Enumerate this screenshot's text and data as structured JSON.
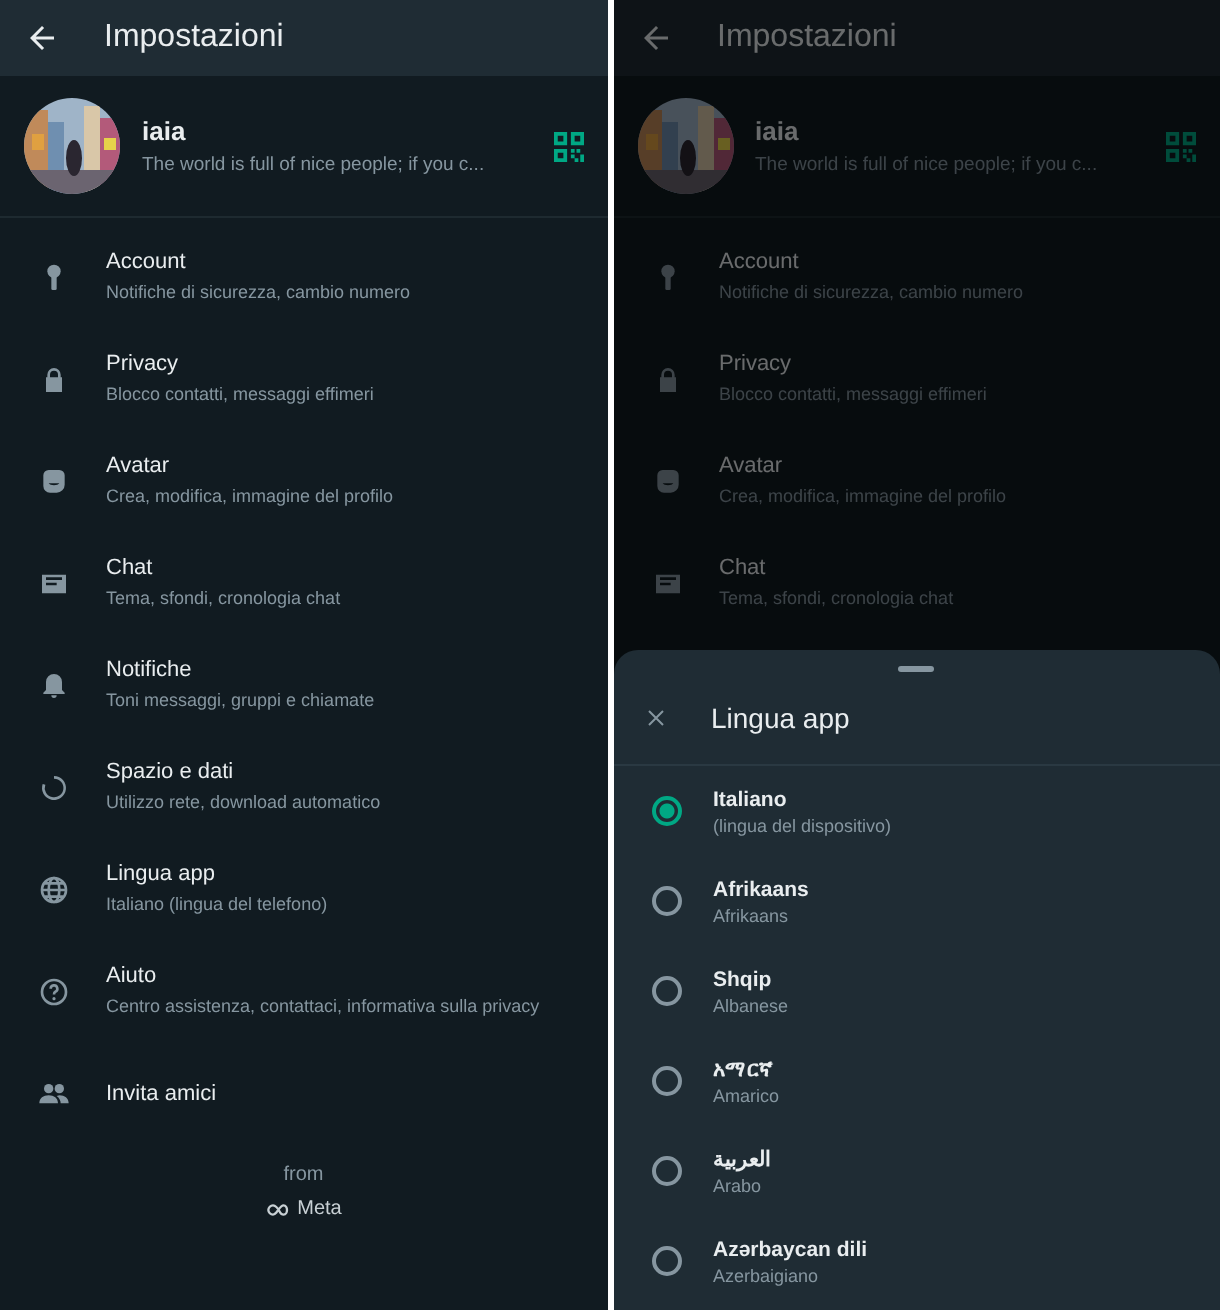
{
  "screens": [
    {
      "dimmed": false,
      "title": "Impostazioni",
      "profile": {
        "name": "iaia",
        "status": "The world is full of nice people; if you c..."
      },
      "items": [
        {
          "kind": "account",
          "title": "Account",
          "subtitle": "Notifiche di sicurezza, cambio numero"
        },
        {
          "kind": "privacy",
          "title": "Privacy",
          "subtitle": "Blocco contatti, messaggi effimeri"
        },
        {
          "kind": "avatar",
          "title": "Avatar",
          "subtitle": "Crea, modifica, immagine del profilo"
        },
        {
          "kind": "chat",
          "title": "Chat",
          "subtitle": "Tema, sfondi, cronologia chat"
        },
        {
          "kind": "notifications",
          "title": "Notifiche",
          "subtitle": "Toni messaggi, gruppi e chiamate"
        },
        {
          "kind": "storage",
          "title": "Spazio e dati",
          "subtitle": "Utilizzo rete, download automatico"
        },
        {
          "kind": "language",
          "title": "Lingua app",
          "subtitle": "Italiano (lingua del telefono)"
        },
        {
          "kind": "help",
          "title": "Aiuto",
          "subtitle": "Centro assistenza, contattaci, informativa sulla privacy"
        },
        {
          "kind": "invite",
          "title": "Invita amici"
        }
      ],
      "footer": {
        "from": "from",
        "brand": "Meta"
      }
    },
    {
      "dimmed": true,
      "title": "Impostazioni",
      "profile": {
        "name": "iaia",
        "status": "The world is full of nice people; if you c..."
      },
      "items": [
        {
          "kind": "account",
          "title": "Account",
          "subtitle": "Notifiche di sicurezza, cambio numero"
        },
        {
          "kind": "privacy",
          "title": "Privacy",
          "subtitle": "Blocco contatti, messaggi effimeri"
        },
        {
          "kind": "avatar",
          "title": "Avatar",
          "subtitle": "Crea, modifica, immagine del profilo"
        },
        {
          "kind": "chat",
          "title": "Chat",
          "subtitle": "Tema, sfondi, cronologia chat"
        }
      ],
      "sheet": {
        "title": "Lingua app",
        "options": [
          {
            "name": "Italiano",
            "detail": "(lingua del dispositivo)",
            "selected": true
          },
          {
            "name": "Afrikaans",
            "detail": "Afrikaans",
            "selected": false
          },
          {
            "name": "Shqip",
            "detail": "Albanese",
            "selected": false
          },
          {
            "name": "አማርኛ",
            "detail": "Amarico",
            "selected": false
          },
          {
            "name": "العربية",
            "detail": "Arabo",
            "selected": false
          },
          {
            "name": "Azərbaycan dili",
            "detail": "Azerbaigiano",
            "selected": false
          }
        ]
      }
    }
  ]
}
